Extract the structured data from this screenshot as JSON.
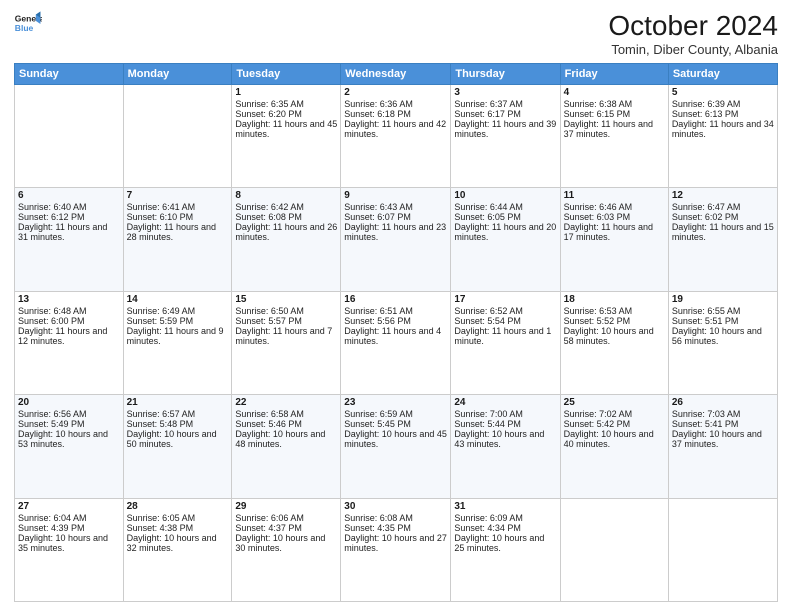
{
  "header": {
    "logo_line1": "General",
    "logo_line2": "Blue",
    "month": "October 2024",
    "location": "Tomin, Diber County, Albania"
  },
  "days_of_week": [
    "Sunday",
    "Monday",
    "Tuesday",
    "Wednesday",
    "Thursday",
    "Friday",
    "Saturday"
  ],
  "weeks": [
    [
      {
        "day": "",
        "sunrise": "",
        "sunset": "",
        "daylight": ""
      },
      {
        "day": "",
        "sunrise": "",
        "sunset": "",
        "daylight": ""
      },
      {
        "day": "1",
        "sunrise": "Sunrise: 6:35 AM",
        "sunset": "Sunset: 6:20 PM",
        "daylight": "Daylight: 11 hours and 45 minutes."
      },
      {
        "day": "2",
        "sunrise": "Sunrise: 6:36 AM",
        "sunset": "Sunset: 6:18 PM",
        "daylight": "Daylight: 11 hours and 42 minutes."
      },
      {
        "day": "3",
        "sunrise": "Sunrise: 6:37 AM",
        "sunset": "Sunset: 6:17 PM",
        "daylight": "Daylight: 11 hours and 39 minutes."
      },
      {
        "day": "4",
        "sunrise": "Sunrise: 6:38 AM",
        "sunset": "Sunset: 6:15 PM",
        "daylight": "Daylight: 11 hours and 37 minutes."
      },
      {
        "day": "5",
        "sunrise": "Sunrise: 6:39 AM",
        "sunset": "Sunset: 6:13 PM",
        "daylight": "Daylight: 11 hours and 34 minutes."
      }
    ],
    [
      {
        "day": "6",
        "sunrise": "Sunrise: 6:40 AM",
        "sunset": "Sunset: 6:12 PM",
        "daylight": "Daylight: 11 hours and 31 minutes."
      },
      {
        "day": "7",
        "sunrise": "Sunrise: 6:41 AM",
        "sunset": "Sunset: 6:10 PM",
        "daylight": "Daylight: 11 hours and 28 minutes."
      },
      {
        "day": "8",
        "sunrise": "Sunrise: 6:42 AM",
        "sunset": "Sunset: 6:08 PM",
        "daylight": "Daylight: 11 hours and 26 minutes."
      },
      {
        "day": "9",
        "sunrise": "Sunrise: 6:43 AM",
        "sunset": "Sunset: 6:07 PM",
        "daylight": "Daylight: 11 hours and 23 minutes."
      },
      {
        "day": "10",
        "sunrise": "Sunrise: 6:44 AM",
        "sunset": "Sunset: 6:05 PM",
        "daylight": "Daylight: 11 hours and 20 minutes."
      },
      {
        "day": "11",
        "sunrise": "Sunrise: 6:46 AM",
        "sunset": "Sunset: 6:03 PM",
        "daylight": "Daylight: 11 hours and 17 minutes."
      },
      {
        "day": "12",
        "sunrise": "Sunrise: 6:47 AM",
        "sunset": "Sunset: 6:02 PM",
        "daylight": "Daylight: 11 hours and 15 minutes."
      }
    ],
    [
      {
        "day": "13",
        "sunrise": "Sunrise: 6:48 AM",
        "sunset": "Sunset: 6:00 PM",
        "daylight": "Daylight: 11 hours and 12 minutes."
      },
      {
        "day": "14",
        "sunrise": "Sunrise: 6:49 AM",
        "sunset": "Sunset: 5:59 PM",
        "daylight": "Daylight: 11 hours and 9 minutes."
      },
      {
        "day": "15",
        "sunrise": "Sunrise: 6:50 AM",
        "sunset": "Sunset: 5:57 PM",
        "daylight": "Daylight: 11 hours and 7 minutes."
      },
      {
        "day": "16",
        "sunrise": "Sunrise: 6:51 AM",
        "sunset": "Sunset: 5:56 PM",
        "daylight": "Daylight: 11 hours and 4 minutes."
      },
      {
        "day": "17",
        "sunrise": "Sunrise: 6:52 AM",
        "sunset": "Sunset: 5:54 PM",
        "daylight": "Daylight: 11 hours and 1 minute."
      },
      {
        "day": "18",
        "sunrise": "Sunrise: 6:53 AM",
        "sunset": "Sunset: 5:52 PM",
        "daylight": "Daylight: 10 hours and 58 minutes."
      },
      {
        "day": "19",
        "sunrise": "Sunrise: 6:55 AM",
        "sunset": "Sunset: 5:51 PM",
        "daylight": "Daylight: 10 hours and 56 minutes."
      }
    ],
    [
      {
        "day": "20",
        "sunrise": "Sunrise: 6:56 AM",
        "sunset": "Sunset: 5:49 PM",
        "daylight": "Daylight: 10 hours and 53 minutes."
      },
      {
        "day": "21",
        "sunrise": "Sunrise: 6:57 AM",
        "sunset": "Sunset: 5:48 PM",
        "daylight": "Daylight: 10 hours and 50 minutes."
      },
      {
        "day": "22",
        "sunrise": "Sunrise: 6:58 AM",
        "sunset": "Sunset: 5:46 PM",
        "daylight": "Daylight: 10 hours and 48 minutes."
      },
      {
        "day": "23",
        "sunrise": "Sunrise: 6:59 AM",
        "sunset": "Sunset: 5:45 PM",
        "daylight": "Daylight: 10 hours and 45 minutes."
      },
      {
        "day": "24",
        "sunrise": "Sunrise: 7:00 AM",
        "sunset": "Sunset: 5:44 PM",
        "daylight": "Daylight: 10 hours and 43 minutes."
      },
      {
        "day": "25",
        "sunrise": "Sunrise: 7:02 AM",
        "sunset": "Sunset: 5:42 PM",
        "daylight": "Daylight: 10 hours and 40 minutes."
      },
      {
        "day": "26",
        "sunrise": "Sunrise: 7:03 AM",
        "sunset": "Sunset: 5:41 PM",
        "daylight": "Daylight: 10 hours and 37 minutes."
      }
    ],
    [
      {
        "day": "27",
        "sunrise": "Sunrise: 6:04 AM",
        "sunset": "Sunset: 4:39 PM",
        "daylight": "Daylight: 10 hours and 35 minutes."
      },
      {
        "day": "28",
        "sunrise": "Sunrise: 6:05 AM",
        "sunset": "Sunset: 4:38 PM",
        "daylight": "Daylight: 10 hours and 32 minutes."
      },
      {
        "day": "29",
        "sunrise": "Sunrise: 6:06 AM",
        "sunset": "Sunset: 4:37 PM",
        "daylight": "Daylight: 10 hours and 30 minutes."
      },
      {
        "day": "30",
        "sunrise": "Sunrise: 6:08 AM",
        "sunset": "Sunset: 4:35 PM",
        "daylight": "Daylight: 10 hours and 27 minutes."
      },
      {
        "day": "31",
        "sunrise": "Sunrise: 6:09 AM",
        "sunset": "Sunset: 4:34 PM",
        "daylight": "Daylight: 10 hours and 25 minutes."
      },
      {
        "day": "",
        "sunrise": "",
        "sunset": "",
        "daylight": ""
      },
      {
        "day": "",
        "sunrise": "",
        "sunset": "",
        "daylight": ""
      }
    ]
  ]
}
